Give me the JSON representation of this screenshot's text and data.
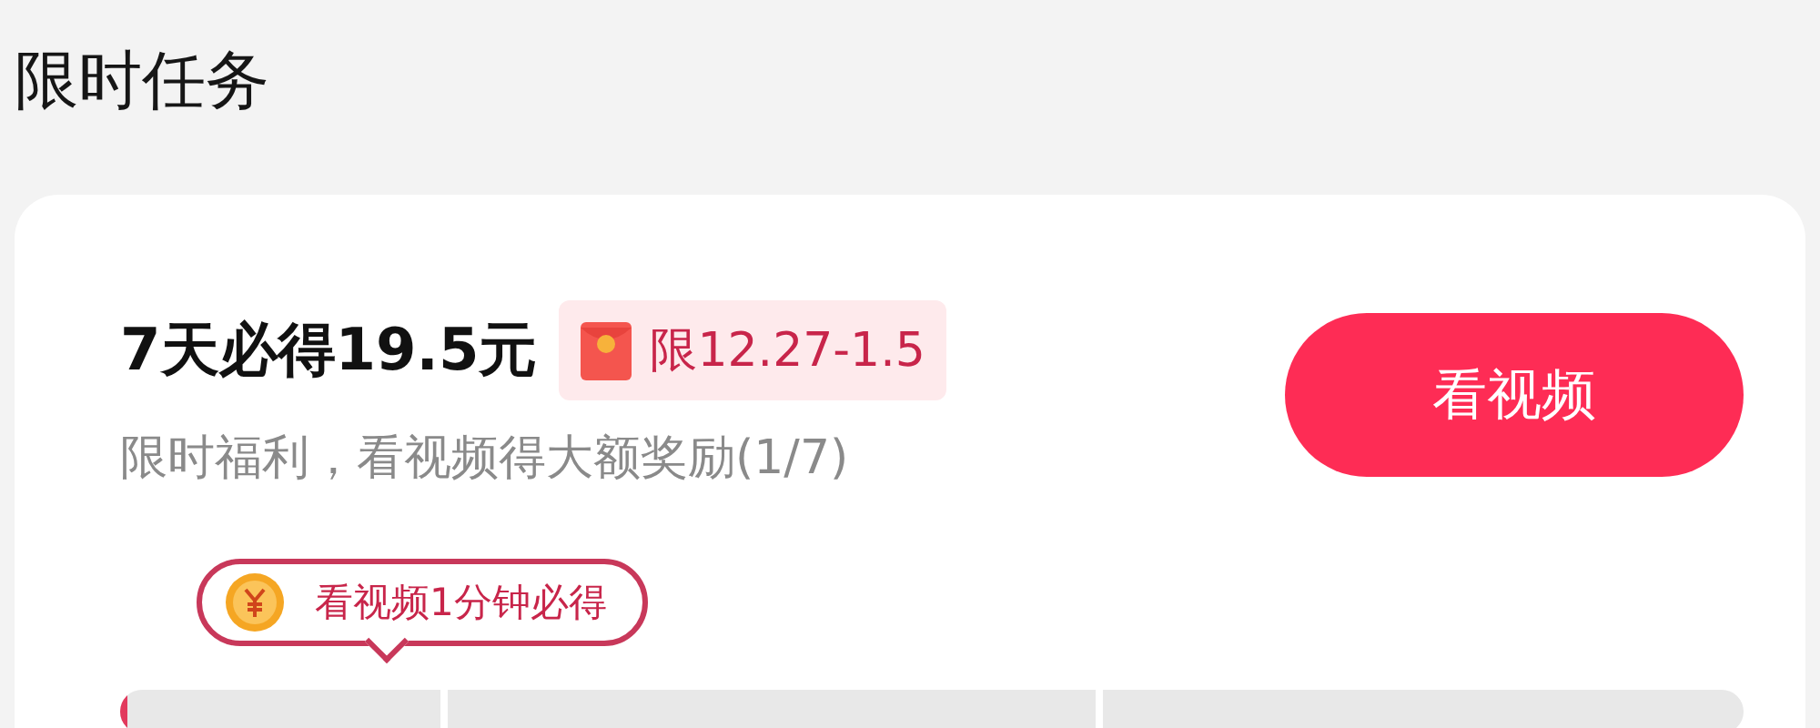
{
  "section_title": "限时任务",
  "task": {
    "title": "7天必得19.5元",
    "badge": "限12.27-1.5",
    "subtitle": "限时福利，看视频得大额奖励(1/7)",
    "button": "看视频",
    "tip": "看视频1分钟必得",
    "progress": {
      "level": 0.004
    }
  }
}
